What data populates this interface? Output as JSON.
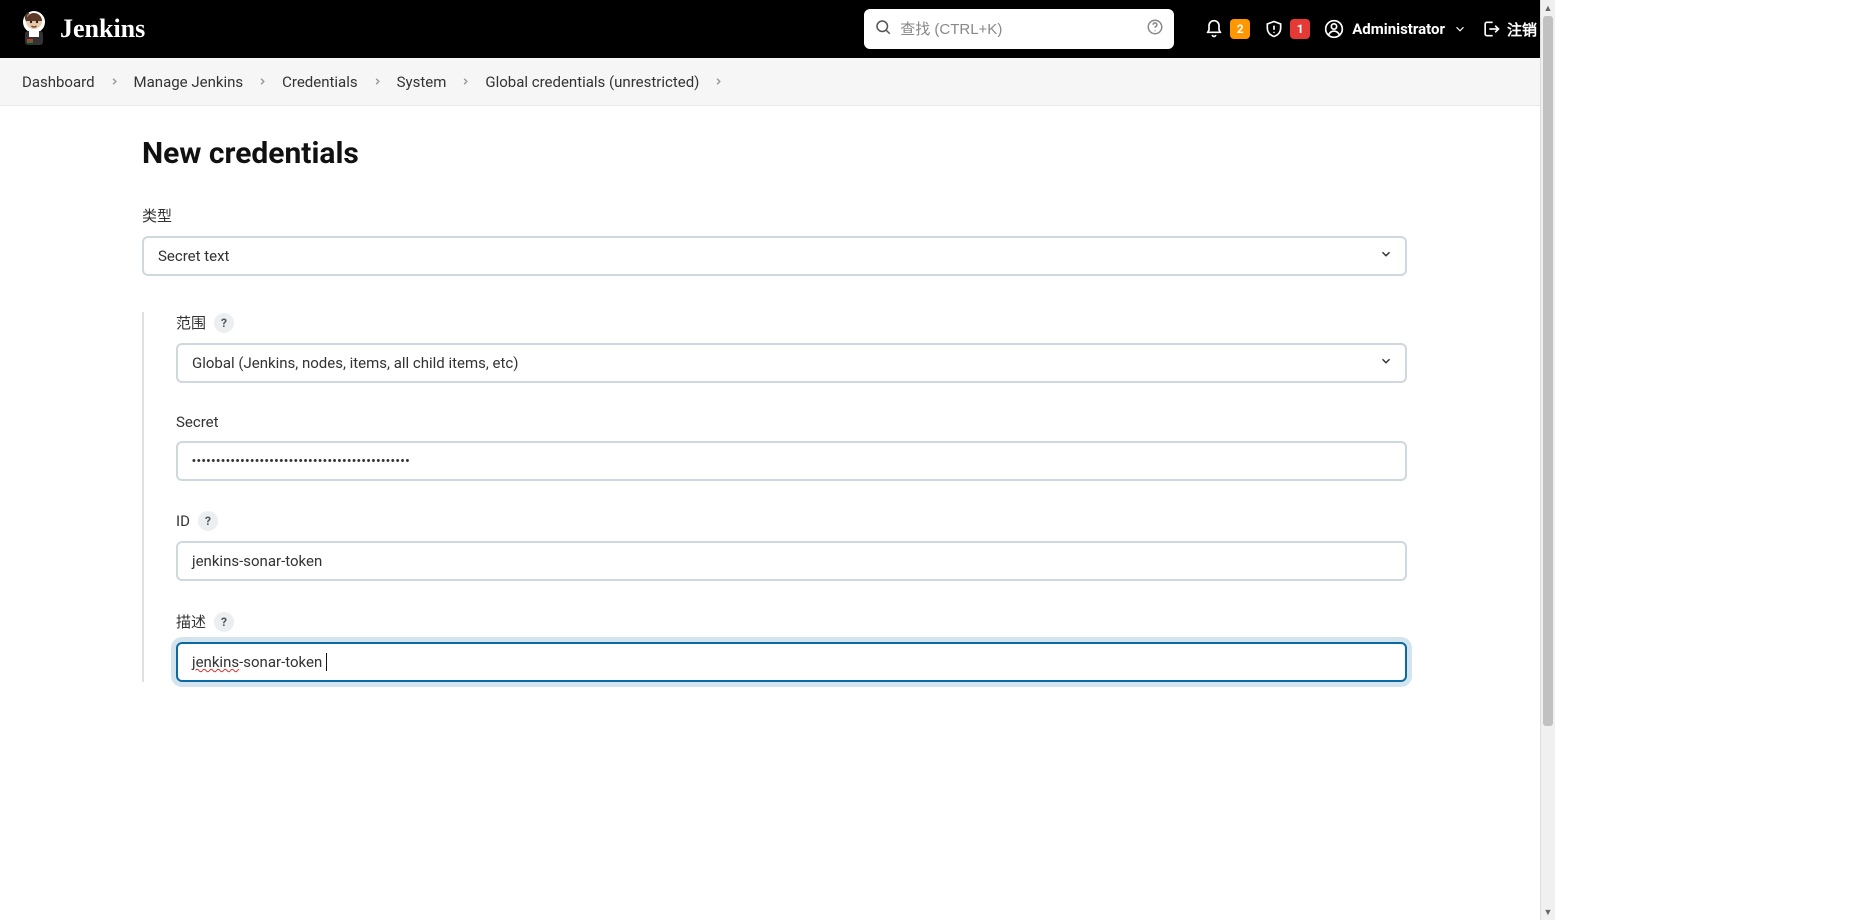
{
  "header": {
    "brand": "Jenkins",
    "search_placeholder": "查找 (CTRL+K)",
    "notif_badge": "2",
    "alert_badge": "1",
    "user": "Administrator",
    "logout": "注销"
  },
  "breadcrumbs": [
    "Dashboard",
    "Manage Jenkins",
    "Credentials",
    "System",
    "Global credentials (unrestricted)"
  ],
  "page": {
    "title": "New credentials"
  },
  "form": {
    "type_label": "类型",
    "type_value": "Secret text",
    "scope_label": "范围",
    "scope_value": "Global (Jenkins, nodes, items, all child items, etc)",
    "secret_label": "Secret",
    "secret_value": "•••••••••••••••••••••••••••••••••••••••••••••",
    "id_label": "ID",
    "id_value": "jenkins-sonar-token",
    "desc_label": "描述",
    "desc_value_prefix": "jenkins",
    "desc_value_suffix": "-sonar-token",
    "help": "?"
  }
}
